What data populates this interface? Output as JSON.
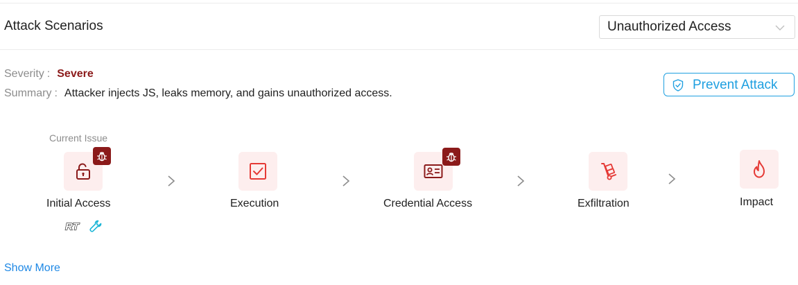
{
  "section": {
    "title": "Attack Scenarios"
  },
  "scenario_select": {
    "value": "Unauthorized Access",
    "icon": "chevron-down-icon"
  },
  "severity": {
    "label": "Severity",
    "value": "Severe"
  },
  "summary": {
    "label": "Summary",
    "value": "Attacker injects JS, leaks memory, and gains unauthorized access."
  },
  "prevent_button": {
    "label": "Prevent Attack",
    "icon": "shield-check-icon"
  },
  "current_issue_label": "Current Issue",
  "stages": [
    {
      "name": "Initial Access",
      "icon": "unlock-icon",
      "has_issue": true
    },
    {
      "name": "Execution",
      "icon": "checkbox-icon",
      "has_issue": false
    },
    {
      "name": "Credential Access",
      "icon": "id-card-icon",
      "has_issue": true
    },
    {
      "name": "Exfiltration",
      "icon": "hand-truck-icon",
      "has_issue": false
    },
    {
      "name": "Impact",
      "icon": "flame-icon",
      "has_issue": false
    }
  ],
  "tools": [
    {
      "name": "rt-icon"
    },
    {
      "name": "wrench-icon"
    }
  ],
  "show_more": "Show More",
  "colors": {
    "severe": "#8b1a1a",
    "accent_blue": "#1e9fe0",
    "link_blue": "#1e88e5",
    "stage_bg": "#fdeeee",
    "stage_icon_dark": "#8b1a1a",
    "stage_icon_light": "#e53935",
    "badge_bg": "#8b1a1a",
    "wrench": "#1ab5d6"
  }
}
